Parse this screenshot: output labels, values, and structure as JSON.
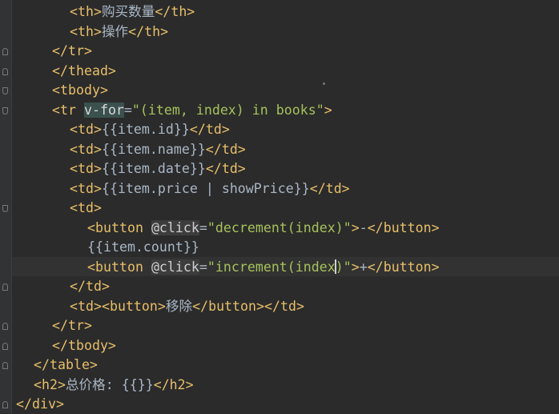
{
  "lines": [
    {
      "segs": [
        {
          "c": "tag",
          "t": "<th>"
        },
        {
          "c": "txt",
          "t": "购买数量"
        },
        {
          "c": "tag",
          "t": "</th>"
        }
      ]
    },
    {
      "segs": [
        {
          "c": "tag",
          "t": "<th>"
        },
        {
          "c": "txt",
          "t": "操作"
        },
        {
          "c": "tag",
          "t": "</th>"
        }
      ]
    },
    {
      "segs": [
        {
          "c": "tag",
          "t": "</tr>"
        }
      ]
    },
    {
      "segs": [
        {
          "c": "tag",
          "t": "</thead>"
        }
      ]
    },
    {
      "segs": [
        {
          "c": "tag",
          "t": "<tbody>"
        }
      ]
    },
    {
      "segs": [
        {
          "c": "tag",
          "t": "<tr "
        },
        {
          "c": "vfor",
          "t": "v-for"
        },
        {
          "c": "eq",
          "t": "="
        },
        {
          "c": "str",
          "t": "\"(item, index) in books\""
        },
        {
          "c": "tag",
          "t": ">"
        }
      ]
    },
    {
      "segs": [
        {
          "c": "tag",
          "t": "<td>"
        },
        {
          "c": "txt",
          "t": "{{item.id}}"
        },
        {
          "c": "tag",
          "t": "</td>"
        }
      ]
    },
    {
      "segs": [
        {
          "c": "tag",
          "t": "<td>"
        },
        {
          "c": "txt",
          "t": "{{item.name}}"
        },
        {
          "c": "tag",
          "t": "</td>"
        }
      ]
    },
    {
      "segs": [
        {
          "c": "tag",
          "t": "<td>"
        },
        {
          "c": "txt",
          "t": "{{item.date}}"
        },
        {
          "c": "tag",
          "t": "</td>"
        }
      ]
    },
    {
      "segs": [
        {
          "c": "tag",
          "t": "<td>"
        },
        {
          "c": "txt",
          "t": "{{item.price | showPrice}}"
        },
        {
          "c": "tag",
          "t": "</td>"
        }
      ]
    },
    {
      "segs": [
        {
          "c": "tag",
          "t": "<td>"
        }
      ]
    },
    {
      "segs": [
        {
          "c": "tag",
          "t": "<button "
        },
        {
          "c": "at",
          "t": "@click"
        },
        {
          "c": "eq",
          "t": "="
        },
        {
          "c": "str",
          "t": "\"decrement(index)\""
        },
        {
          "c": "tag",
          "t": ">"
        },
        {
          "c": "txt",
          "t": "-"
        },
        {
          "c": "tag",
          "t": "</button>"
        }
      ]
    },
    {
      "segs": [
        {
          "c": "txt",
          "t": "{{item.count}}"
        }
      ]
    },
    {
      "segs": [
        {
          "c": "tag",
          "t": "<button "
        },
        {
          "c": "at",
          "t": "@click"
        },
        {
          "c": "eq",
          "t": "="
        },
        {
          "c": "str",
          "t": "\"increment(index"
        },
        {
          "c": "caret",
          "t": ""
        },
        {
          "c": "str",
          "t": ")\""
        },
        {
          "c": "tag",
          "t": ">"
        },
        {
          "c": "txt",
          "t": "+"
        },
        {
          "c": "tag",
          "t": "</button>"
        }
      ]
    },
    {
      "segs": [
        {
          "c": "tag",
          "t": "</td>"
        }
      ]
    },
    {
      "segs": [
        {
          "c": "tag",
          "t": "<td>"
        },
        {
          "c": "tag",
          "t": "<button>"
        },
        {
          "c": "txt",
          "t": "移除"
        },
        {
          "c": "tag",
          "t": "</button>"
        },
        {
          "c": "tag",
          "t": "</td>"
        }
      ]
    },
    {
      "segs": [
        {
          "c": "tag",
          "t": "</tr>"
        }
      ]
    },
    {
      "segs": [
        {
          "c": "tag",
          "t": "</tbody>"
        }
      ]
    },
    {
      "segs": [
        {
          "c": "tag",
          "t": "</table>"
        }
      ]
    },
    {
      "segs": [
        {
          "c": "tag",
          "t": "<h2>"
        },
        {
          "c": "txt",
          "t": "总价格: {{}}"
        },
        {
          "c": "tag",
          "t": "</h2>"
        }
      ]
    },
    {
      "segs": [
        {
          "c": "tag",
          "t": "</div>"
        }
      ]
    }
  ],
  "colors": {
    "background": "#2b2b2b",
    "tag": "#e8bf6a",
    "string": "#a5c25c",
    "text": "#a9b7c6"
  }
}
